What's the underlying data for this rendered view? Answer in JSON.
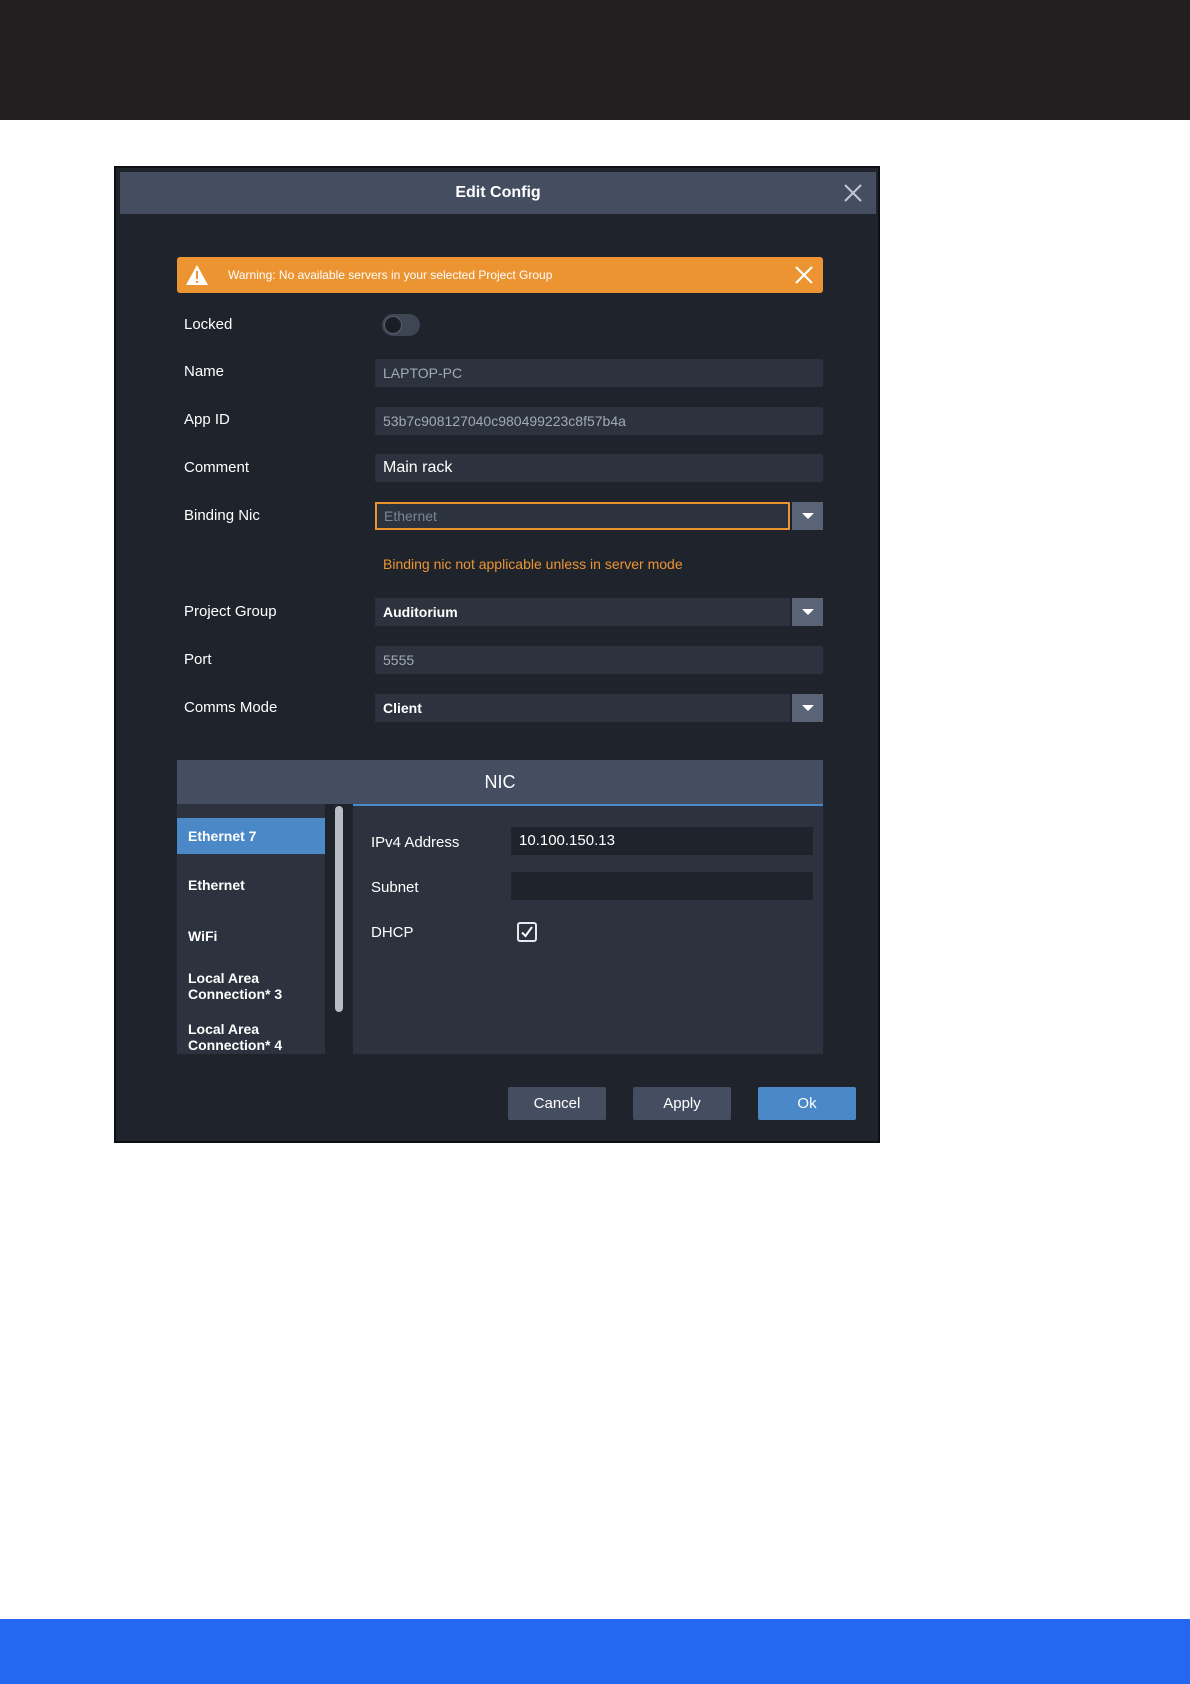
{
  "dialog": {
    "title": "Edit Config"
  },
  "warning": {
    "text": "Warning: No available servers in your selected Project Group"
  },
  "fields": {
    "locked_label": "Locked",
    "locked_value": false,
    "name_label": "Name",
    "name_value": "LAPTOP-PC",
    "app_id_label": "App ID",
    "app_id_value": "53b7c908127040c980499223c8f57b4a",
    "comment_label": "Comment",
    "comment_value": "Main rack",
    "binding_nic_label": "Binding Nic",
    "binding_nic_value": "Ethernet",
    "binding_nic_hint": "Binding nic not applicable unless in server mode",
    "project_group_label": "Project Group",
    "project_group_value": "Auditorium",
    "port_label": "Port",
    "port_value": "5555",
    "comms_mode_label": "Comms Mode",
    "comms_mode_value": "Client"
  },
  "nic": {
    "header": "NIC",
    "items": [
      "Ethernet 7",
      "Ethernet",
      "WiFi",
      "Local Area Connection* 3",
      "Local Area Connection* 4"
    ],
    "selected_item": "Ethernet 7",
    "ipv4_label": "IPv4 Address",
    "ipv4_value": "10.100.150.13",
    "subnet_label": "Subnet",
    "subnet_value": "",
    "dhcp_label": "DHCP",
    "dhcp_checked": true
  },
  "buttons": {
    "cancel": "Cancel",
    "apply": "Apply",
    "ok": "Ok"
  },
  "colors": {
    "accent_orange": "#ec9432",
    "accent_blue": "#4a88c8",
    "panel": "#1f242c",
    "header": "#454e61",
    "top_bar": "#231f20",
    "bottom_bar": "#2468f2"
  }
}
